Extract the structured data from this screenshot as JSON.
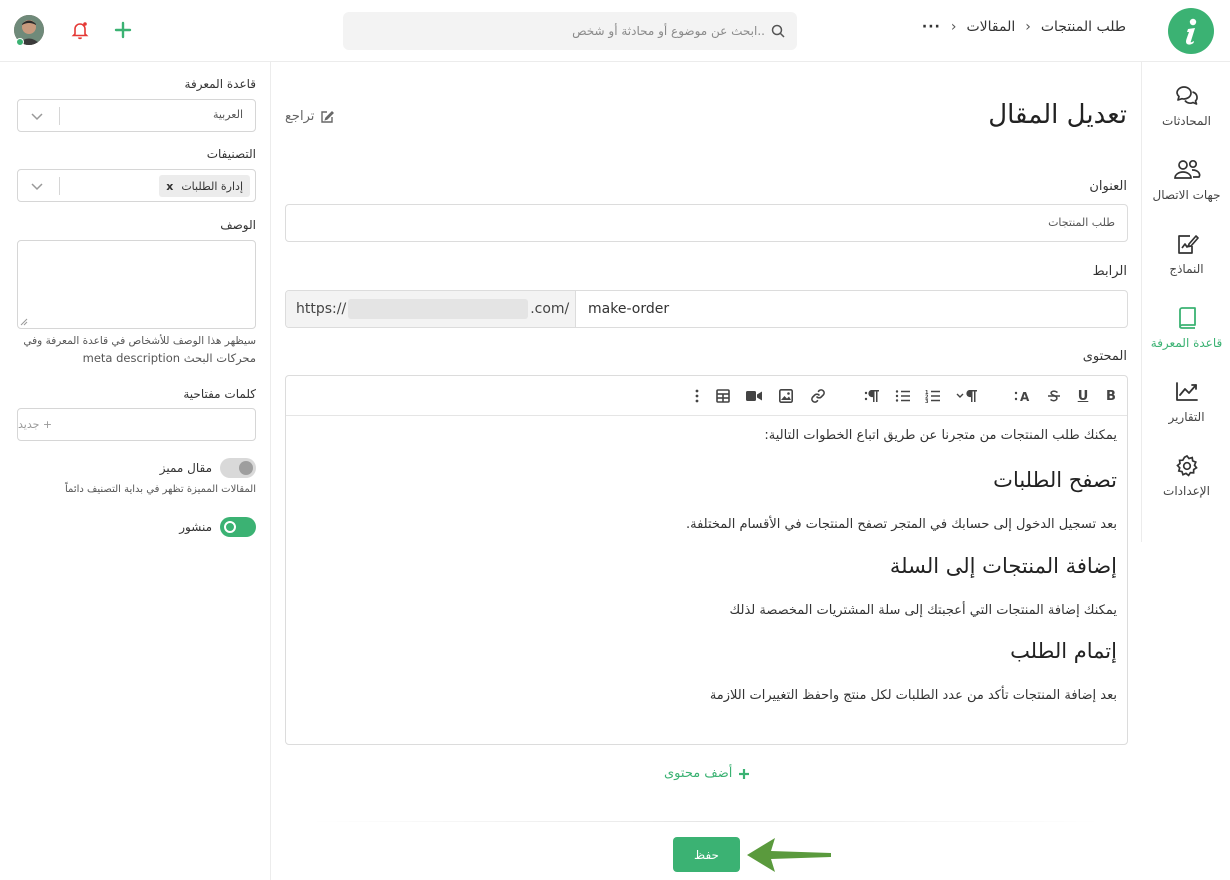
{
  "topbar": {
    "breadcrumb": [
      "المقالات",
      "طلب المنتجات"
    ],
    "search_placeholder": "ابحث عن موضوع أو محادثة أو شخص.."
  },
  "sidenav": {
    "items": [
      {
        "label": "المحادثات",
        "icon": "chat-icon"
      },
      {
        "label": "جهات الاتصال",
        "icon": "contacts-icon"
      },
      {
        "label": "النماذج",
        "icon": "forms-icon"
      },
      {
        "label": "قاعدة المعرفة",
        "icon": "book-icon",
        "active": true
      },
      {
        "label": "التقارير",
        "icon": "chart-icon"
      },
      {
        "label": "الإعدادات",
        "icon": "gear-icon"
      }
    ]
  },
  "main": {
    "page_title": "تعديل المقال",
    "revisions_label": "تراجع",
    "title_label": "العنوان",
    "title_value": "طلب المنتجات",
    "url_label": "الرابط",
    "url_prefix_start": "https://",
    "url_prefix_end": ".com/",
    "url_slug": "make-order",
    "content_label": "المحتوى",
    "content": {
      "p1": "يمكنك طلب المنتجات من متجرنا عن طريق اتباع الخطوات التالية:",
      "h1": "تصفح الطلبات",
      "p2": "بعد تسجيل الدخول إلى حسابك في المتجر تصفح المنتجات في الأقسام المختلفة.",
      "h2": "إضافة المنتجات إلى السلة",
      "p3": "يمكنك إضافة المنتجات التي أعجبتك إلى سلة المشتريات المخصصة لذلك",
      "h3": "إتمام الطلب",
      "p4": "بعد إضافة المنتجات تأكد من عدد الطلبات لكل منتج واحفظ التغييرات اللازمة"
    },
    "add_content_label": "أضف محتوى",
    "save_label": "حفظ"
  },
  "leftpanel": {
    "kb_label": "قاعدة المعرفة",
    "kb_value": "العربية",
    "categories_label": "التصنيفات",
    "category_chip": "إدارة الطلبات",
    "chip_remove": "x",
    "description_label": "الوصف",
    "description_hint_1": "سيظهر هذا الوصف للأشخاص في قاعدة المعرفة وفي",
    "description_hint_2": "محركات البحث meta description",
    "keywords_label": "كلمات مفتاحية",
    "keywords_placeholder": "+ جديد",
    "featured_label": "مقال مميز",
    "featured_hint": "المقالات المميزة تظهر في بداية التصنيف دائماً",
    "published_label": "منشور"
  },
  "colors": {
    "accent": "#3bb273",
    "notification": "#e53935"
  }
}
